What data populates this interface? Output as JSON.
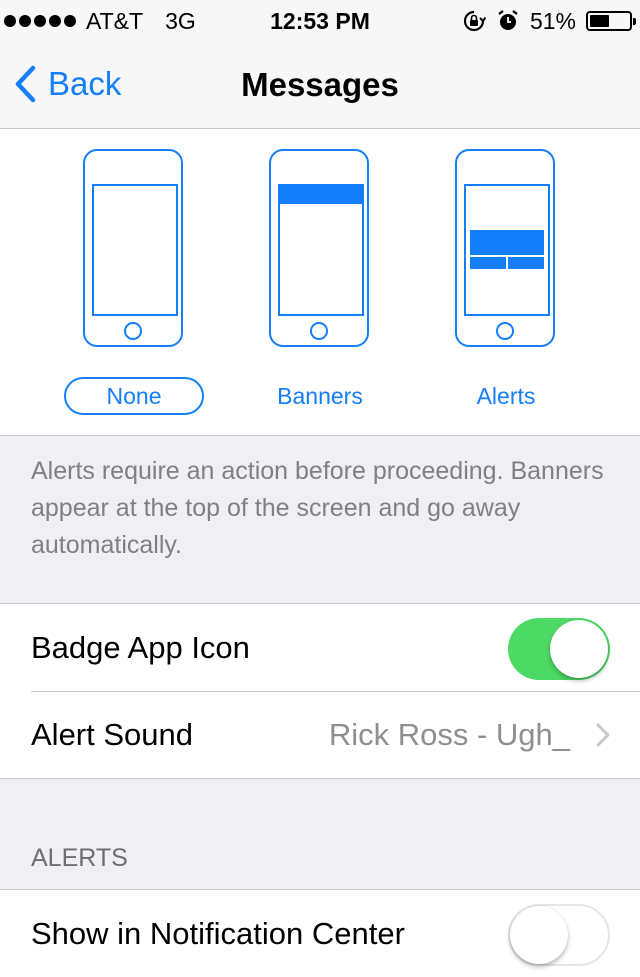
{
  "status_bar": {
    "carrier": "AT&T",
    "network": "3G",
    "time": "12:53 PM",
    "battery": "51%",
    "battery_level": 0.51,
    "signal_bars": 5
  },
  "nav": {
    "back_label": "Back",
    "title": "Messages"
  },
  "alert_style": {
    "options": [
      "None",
      "Banners",
      "Alerts"
    ],
    "selected": "None"
  },
  "description": "Alerts require an action before proceeding. Banners appear at the top of the screen and go away automatically.",
  "settings": {
    "badge_app_icon": {
      "label": "Badge App Icon",
      "enabled": true
    },
    "alert_sound": {
      "label": "Alert Sound",
      "value": "Rick Ross - Ugh_"
    }
  },
  "alerts_section": {
    "header": "ALERTS",
    "show_in_notification_center": {
      "label": "Show in Notification Center",
      "enabled": false
    }
  },
  "colors": {
    "accent": "#157efb",
    "toggle_on": "#4cd964",
    "background": "#efeff4"
  }
}
